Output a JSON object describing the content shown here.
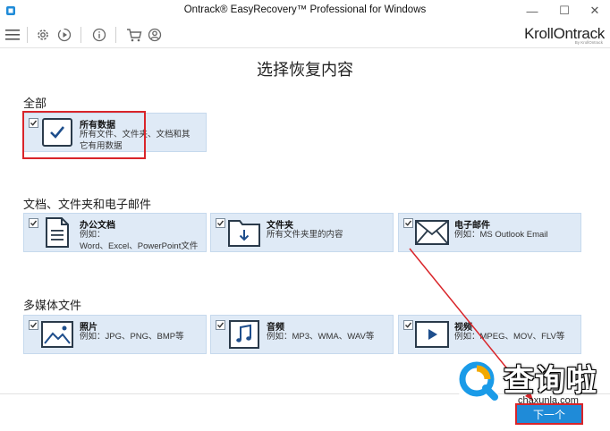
{
  "window": {
    "title": "Ontrack® EasyRecovery™ Professional for Windows",
    "minimize": "—",
    "maximize": "☐",
    "close": "✕"
  },
  "toolbar": {
    "brand_name": "KrollOntrack",
    "brand_sub": "By KrollOntrack"
  },
  "page_title": "选择恢复内容",
  "sections": [
    {
      "title": "全部"
    },
    {
      "title": "文档、文件夹和电子邮件"
    },
    {
      "title": "多媒体文件"
    }
  ],
  "cards": {
    "all_data": {
      "name": "所有数据",
      "desc": "所有文件、文件夹、文档和其\n它有用数据",
      "checked": true
    },
    "office_docs": {
      "name": "办公文档",
      "desc": "例如：\nWord、Excel、PowerPoint文件",
      "checked": true
    },
    "folders": {
      "name": "文件夹",
      "desc": "所有文件夹里的内容",
      "checked": true
    },
    "email": {
      "name": "电子邮件",
      "desc": "例如：MS Outlook Email",
      "checked": true
    },
    "photos": {
      "name": "照片",
      "desc": "例如：JPG、PNG、BMP等",
      "checked": true
    },
    "audio": {
      "name": "音频",
      "desc": "例如：MP3、WMA、WAV等",
      "checked": true
    },
    "video": {
      "name": "视频",
      "desc": "例如：MPEG、MOV、FLV等",
      "checked": true
    }
  },
  "next_button": "下一个",
  "watermark": {
    "cn": "查询啦",
    "en": "chaxunla.com"
  },
  "colors": {
    "card_bg": "#dfeaf6",
    "accent": "#1f8bd8",
    "annotation": "#d9252a"
  }
}
